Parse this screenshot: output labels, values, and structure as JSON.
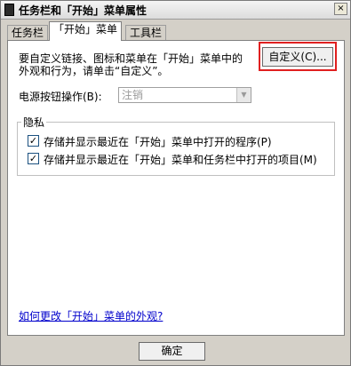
{
  "window": {
    "title": "任务栏和「开始」菜单属性",
    "close": "×"
  },
  "tabs": [
    {
      "label": "任务栏"
    },
    {
      "label": "「开始」菜单"
    },
    {
      "label": "工具栏"
    }
  ],
  "start_menu": {
    "description_line1": "要自定义链接、图标和菜单在「开始」菜单中的",
    "description_line2": "外观和行为，请单击“自定义”。",
    "customize_button": "自定义(C)...",
    "power_label": "电源按钮操作(B):",
    "power_value": "注销",
    "privacy_title": "隐私",
    "privacy_options": [
      {
        "label": "存储并显示最近在「开始」菜单中打开的程序(P)",
        "checked": true
      },
      {
        "label": "存储并显示最近在「开始」菜单和任务栏中打开的项目(M)",
        "checked": true
      }
    ],
    "help_link": "如何更改「开始」菜单的外观?"
  },
  "footer": {
    "ok_button": "确定"
  }
}
